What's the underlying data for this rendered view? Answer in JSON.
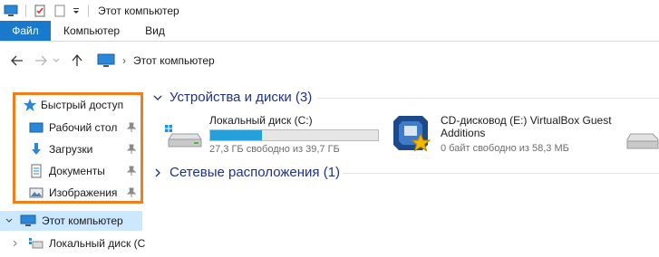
{
  "window": {
    "title": "Этот компьютер"
  },
  "ribbon": {
    "tabs": [
      {
        "label": "Файл",
        "active": true
      },
      {
        "label": "Компьютер",
        "active": false
      },
      {
        "label": "Вид",
        "active": false
      }
    ]
  },
  "address": {
    "path_separator": "›",
    "current": "Этот компьютер"
  },
  "sidebar": {
    "quick_access": {
      "label": "Быстрый доступ",
      "items": [
        {
          "label": "Рабочий стол",
          "icon": "desktop-icon",
          "pinned": true
        },
        {
          "label": "Загрузки",
          "icon": "downloads-icon",
          "pinned": true
        },
        {
          "label": "Документы",
          "icon": "documents-icon",
          "pinned": true
        },
        {
          "label": "Изображения",
          "icon": "pictures-icon",
          "pinned": true
        }
      ]
    },
    "this_pc": {
      "label": "Этот компьютер"
    },
    "local_disk": {
      "label": "Локальный диск (C"
    }
  },
  "main": {
    "devices_group": {
      "label": "Устройства и диски (3)"
    },
    "network_group": {
      "label": "Сетевые расположения (1)"
    },
    "drives": [
      {
        "name": "Локальный диск (C:)",
        "free_text": "27,3 ГБ свободно из 39,7 ГБ",
        "used_fraction": 0.31
      },
      {
        "name_line1": "CD-дисковод (E:) VirtualBox Guest",
        "name_line2": "Additions",
        "free_text": "0 байт свободно из 58,3 МБ"
      }
    ]
  },
  "colors": {
    "accent": "#1979ca",
    "highlight_box": "#f07f1a",
    "selection": "#cce8ff",
    "group_header": "#1e3287",
    "usage_bar": "#26a0da"
  }
}
